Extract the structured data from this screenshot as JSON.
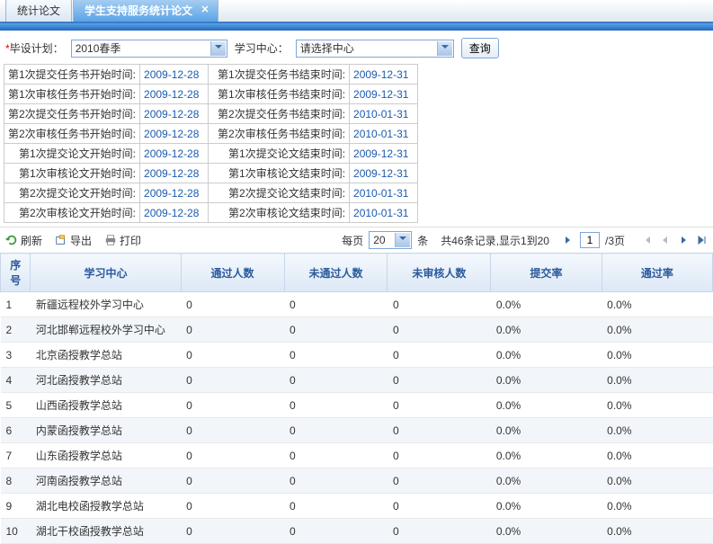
{
  "tabs": {
    "inactive": "统计论文",
    "active": "学生支持服务统计论文",
    "close_glyph": "✕"
  },
  "filter": {
    "plan_label": "毕设计划：",
    "plan_value": "2010春季",
    "center_label": "学习中心：",
    "center_placeholder": "请选择中心",
    "query_label": "查询"
  },
  "time_rows": [
    {
      "l1": "第1次提交任务书开始时间:",
      "v1": "2009-12-28",
      "l2": "第1次提交任务书结束时间:",
      "v2": "2009-12-31"
    },
    {
      "l1": "第1次审核任务书开始时间:",
      "v1": "2009-12-28",
      "l2": "第1次审核任务书结束时间:",
      "v2": "2009-12-31"
    },
    {
      "l1": "第2次提交任务书开始时间:",
      "v1": "2009-12-28",
      "l2": "第2次提交任务书结束时间:",
      "v2": "2010-01-31"
    },
    {
      "l1": "第2次审核任务书开始时间:",
      "v1": "2009-12-28",
      "l2": "第2次审核任务书结束时间:",
      "v2": "2010-01-31"
    },
    {
      "l1": "第1次提交论文开始时间:",
      "v1": "2009-12-28",
      "l2": "第1次提交论文结束时间:",
      "v2": "2009-12-31"
    },
    {
      "l1": "第1次审核论文开始时间:",
      "v1": "2009-12-28",
      "l2": "第1次审核论文结束时间:",
      "v2": "2009-12-31"
    },
    {
      "l1": "第2次提交论文开始时间:",
      "v1": "2009-12-28",
      "l2": "第2次提交论文结束时间:",
      "v2": "2010-01-31"
    },
    {
      "l1": "第2次审核论文开始时间:",
      "v1": "2009-12-28",
      "l2": "第2次审核论文结束时间:",
      "v2": "2010-01-31"
    }
  ],
  "toolbar": {
    "refresh": "刷新",
    "export": "导出",
    "print": "打印",
    "per_page_label": "每页",
    "per_page_value": "20",
    "per_page_suffix": "条",
    "record_info": "共46条记录,显示1到20",
    "goto_value": "1",
    "page_total": "/3页"
  },
  "columns": {
    "seq": "序号",
    "center": "学习中心",
    "pass": "通过人数",
    "fail": "未通过人数",
    "unrev": "未审核人数",
    "submit_rate": "提交率",
    "pass_rate": "通过率"
  },
  "rows": [
    {
      "seq": "1",
      "center": "新疆远程校外学习中心",
      "pass": "0",
      "fail": "0",
      "unrev": "0",
      "srate": "0.0%",
      "prate": "0.0%"
    },
    {
      "seq": "2",
      "center": "河北邯郸远程校外学习中心",
      "pass": "0",
      "fail": "0",
      "unrev": "0",
      "srate": "0.0%",
      "prate": "0.0%"
    },
    {
      "seq": "3",
      "center": "北京函授教学总站",
      "pass": "0",
      "fail": "0",
      "unrev": "0",
      "srate": "0.0%",
      "prate": "0.0%"
    },
    {
      "seq": "4",
      "center": "河北函授教学总站",
      "pass": "0",
      "fail": "0",
      "unrev": "0",
      "srate": "0.0%",
      "prate": "0.0%"
    },
    {
      "seq": "5",
      "center": "山西函授教学总站",
      "pass": "0",
      "fail": "0",
      "unrev": "0",
      "srate": "0.0%",
      "prate": "0.0%"
    },
    {
      "seq": "6",
      "center": "内蒙函授教学总站",
      "pass": "0",
      "fail": "0",
      "unrev": "0",
      "srate": "0.0%",
      "prate": "0.0%"
    },
    {
      "seq": "7",
      "center": "山东函授教学总站",
      "pass": "0",
      "fail": "0",
      "unrev": "0",
      "srate": "0.0%",
      "prate": "0.0%"
    },
    {
      "seq": "8",
      "center": "河南函授教学总站",
      "pass": "0",
      "fail": "0",
      "unrev": "0",
      "srate": "0.0%",
      "prate": "0.0%"
    },
    {
      "seq": "9",
      "center": "湖北电校函授教学总站",
      "pass": "0",
      "fail": "0",
      "unrev": "0",
      "srate": "0.0%",
      "prate": "0.0%"
    },
    {
      "seq": "10",
      "center": "湖北干校函授教学总站",
      "pass": "0",
      "fail": "0",
      "unrev": "0",
      "srate": "0.0%",
      "prate": "0.0%"
    }
  ]
}
